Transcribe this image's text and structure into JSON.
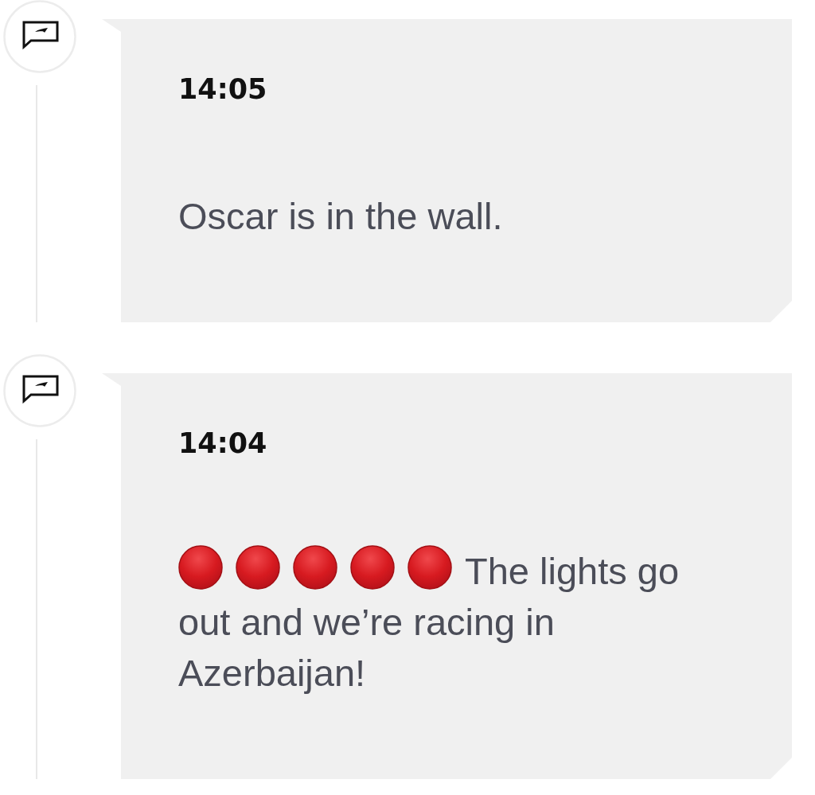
{
  "feed": [
    {
      "time": "14:05",
      "text_parts": [
        "Oscar is in the wall."
      ]
    },
    {
      "time": "14:04",
      "lead_icons": [
        {
          "kind": "circle"
        },
        {
          "kind": "circle"
        },
        {
          "kind": "circle"
        },
        {
          "kind": "circle"
        },
        {
          "kind": "circle"
        }
      ],
      "text_parts": [
        "The lights go",
        "out and we’re racing in Azerbaijan!"
      ]
    }
  ]
}
